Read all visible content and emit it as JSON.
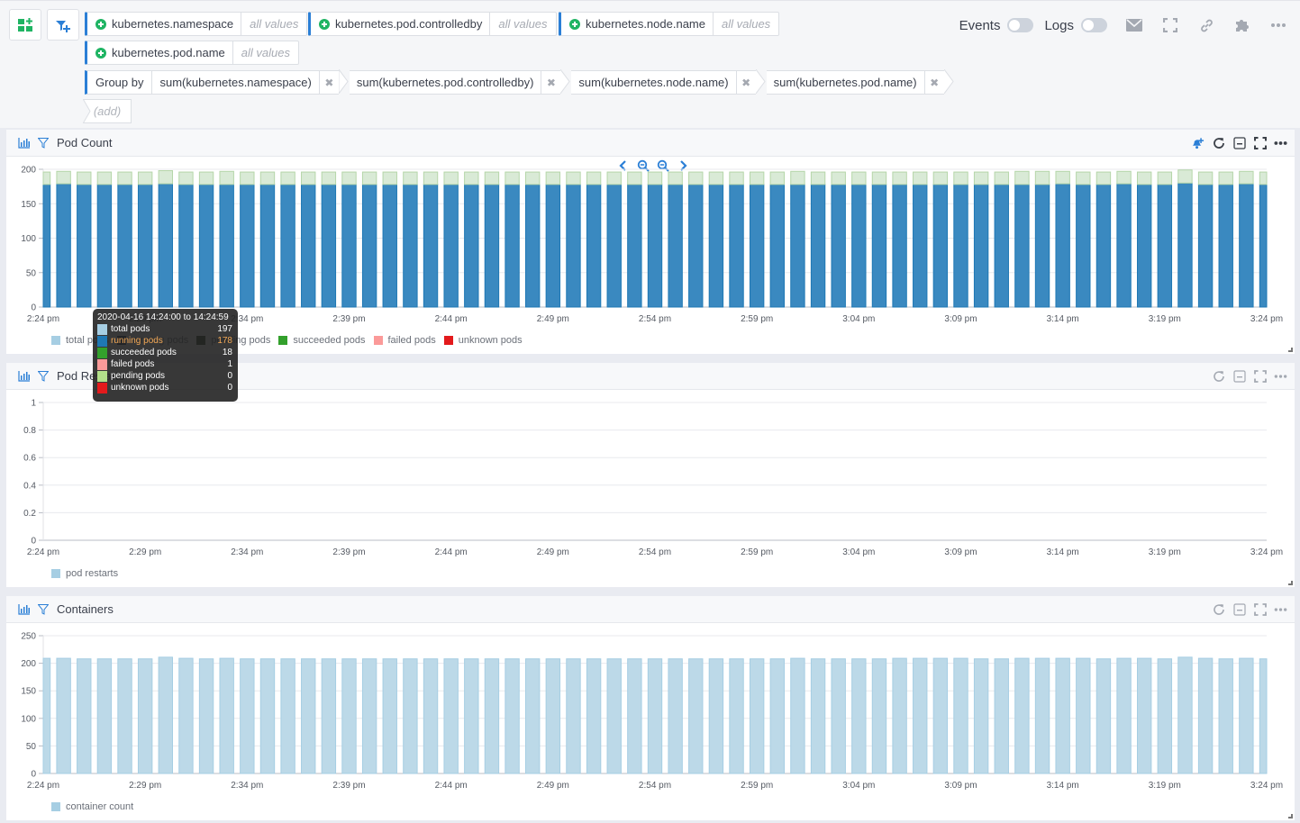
{
  "toolbar": {
    "add_panel_icon": "dashboard-add-icon",
    "add_filter_icon": "filter-add-icon",
    "filters": [
      {
        "key": "kubernetes.namespace",
        "value": "all values"
      },
      {
        "key": "kubernetes.pod.controlledby",
        "value": "all values"
      },
      {
        "key": "kubernetes.node.name",
        "value": "all values"
      },
      {
        "key": "kubernetes.pod.name",
        "value": "all values"
      }
    ],
    "group_by": {
      "label": "Group by",
      "items": [
        "sum(kubernetes.namespace)",
        "sum(kubernetes.pod.controlledby)",
        "sum(kubernetes.node.name)",
        "sum(kubernetes.pod.name)"
      ],
      "remove_glyph": "✖",
      "add_label": "(add)"
    },
    "events_label": "Events",
    "logs_label": "Logs",
    "events_on": false,
    "logs_on": false
  },
  "panels": [
    {
      "title": "Pod Count",
      "has_alert_icon": true
    },
    {
      "title": "Pod Restarts",
      "has_alert_icon": false
    },
    {
      "title": "Containers",
      "has_alert_icon": false
    }
  ],
  "tooltip": {
    "title": "2020-04-16 14:24:00 to 14:24:59",
    "rows": [
      {
        "name": "total pods",
        "value": "197",
        "color": "#a6cee3",
        "highlight": false
      },
      {
        "name": "running pods",
        "value": "178",
        "color": "#1f78b4",
        "highlight": true
      },
      {
        "name": "succeeded pods",
        "value": "18",
        "color": "#33a02c",
        "highlight": false
      },
      {
        "name": "failed pods",
        "value": "1",
        "color": "#fb9a99",
        "highlight": false
      },
      {
        "name": "pending pods",
        "value": "0",
        "color": "#b2df8a",
        "highlight": false
      },
      {
        "name": "unknown pods",
        "value": "0",
        "color": "#e31a1c",
        "highlight": false
      }
    ]
  },
  "chart_data": [
    {
      "type": "bar",
      "title": "Pod Count",
      "stacked": true,
      "x_ticks": [
        "2:24 pm",
        "2:29 pm",
        "2:34 pm",
        "2:39 pm",
        "2:44 pm",
        "2:49 pm",
        "2:54 pm",
        "2:59 pm",
        "3:04 pm",
        "3:09 pm",
        "3:14 pm",
        "3:19 pm",
        "3:24 pm"
      ],
      "x_range_minutes": [
        0,
        60
      ],
      "y_ticks": [
        "0",
        "50",
        "100",
        "150",
        "200"
      ],
      "ylim": [
        0,
        200
      ],
      "grid": true,
      "legend": {
        "placement": "bottom-left",
        "entries": [
          {
            "name": "total pods",
            "color": "#a6cee3"
          },
          {
            "name": "running pods",
            "color": "#1f3552"
          },
          {
            "name": "pending pods",
            "color": "#2f3f24"
          },
          {
            "name": "succeeded pods",
            "color": "#33a02c"
          },
          {
            "name": "failed pods",
            "color": "#fb9a99"
          },
          {
            "name": "unknown pods",
            "color": "#e31a1c"
          }
        ]
      },
      "series": [
        {
          "name": "running pods",
          "color": "#1f78b4",
          "values": [
            178,
            179,
            178,
            178,
            178,
            178,
            179,
            178,
            178,
            178,
            178,
            178,
            178,
            178,
            178,
            178,
            178,
            178,
            178,
            178,
            178,
            178,
            178,
            178,
            178,
            178,
            178,
            178,
            178,
            178,
            178,
            178,
            178,
            178,
            178,
            178,
            178,
            178,
            178,
            178,
            178,
            178,
            178,
            178,
            178,
            178,
            178,
            178,
            178,
            178,
            179,
            178,
            178,
            179,
            178,
            178,
            180,
            178,
            178,
            179,
            178
          ]
        },
        {
          "name": "succeeded pods",
          "color": "#b6d7a8",
          "values": [
            18,
            18,
            18,
            18,
            18,
            18,
            19,
            18,
            18,
            19,
            18,
            18,
            18,
            18,
            18,
            18,
            18,
            18,
            18,
            18,
            18,
            18,
            18,
            18,
            18,
            18,
            18,
            18,
            18,
            18,
            18,
            18,
            18,
            18,
            18,
            18,
            18,
            19,
            18,
            18,
            18,
            18,
            18,
            18,
            18,
            18,
            18,
            18,
            19,
            19,
            18,
            18,
            18,
            18,
            18,
            18,
            19,
            18,
            18,
            18,
            18
          ]
        }
      ]
    },
    {
      "type": "bar",
      "title": "Pod Restarts",
      "x_ticks": [
        "2:24 pm",
        "2:29 pm",
        "2:34 pm",
        "2:39 pm",
        "2:44 pm",
        "2:49 pm",
        "2:54 pm",
        "2:59 pm",
        "3:04 pm",
        "3:09 pm",
        "3:14 pm",
        "3:19 pm",
        "3:24 pm"
      ],
      "y_ticks": [
        "0",
        "0.2",
        "0.4",
        "0.6",
        "0.8",
        "1"
      ],
      "ylim": [
        0,
        1
      ],
      "grid": true,
      "legend": {
        "placement": "bottom-left",
        "entries": [
          {
            "name": "pod restarts",
            "color": "#a6cee3"
          }
        ]
      },
      "series": [
        {
          "name": "pod restarts",
          "values": []
        }
      ]
    },
    {
      "type": "bar",
      "title": "Containers",
      "x_ticks": [
        "2:24 pm",
        "2:29 pm",
        "2:34 pm",
        "2:39 pm",
        "2:44 pm",
        "2:49 pm",
        "2:54 pm",
        "2:59 pm",
        "3:04 pm",
        "3:09 pm",
        "3:14 pm",
        "3:19 pm",
        "3:24 pm"
      ],
      "y_ticks": [
        "0",
        "50",
        "100",
        "150",
        "200",
        "250"
      ],
      "ylim": [
        0,
        250
      ],
      "grid": true,
      "legend": {
        "placement": "bottom-left",
        "entries": [
          {
            "name": "container count",
            "color": "#a6cee3"
          }
        ]
      },
      "series": [
        {
          "name": "container count",
          "color": "#a6cee3",
          "values": [
            209,
            209,
            208,
            208,
            208,
            208,
            211,
            209,
            208,
            209,
            208,
            208,
            208,
            208,
            208,
            208,
            208,
            208,
            208,
            208,
            208,
            208,
            208,
            208,
            208,
            208,
            208,
            208,
            208,
            208,
            208,
            208,
            208,
            208,
            208,
            208,
            208,
            209,
            208,
            208,
            208,
            208,
            209,
            209,
            209,
            209,
            208,
            208,
            209,
            209,
            209,
            209,
            208,
            209,
            209,
            208,
            211,
            209,
            208,
            209,
            208
          ]
        }
      ]
    }
  ]
}
